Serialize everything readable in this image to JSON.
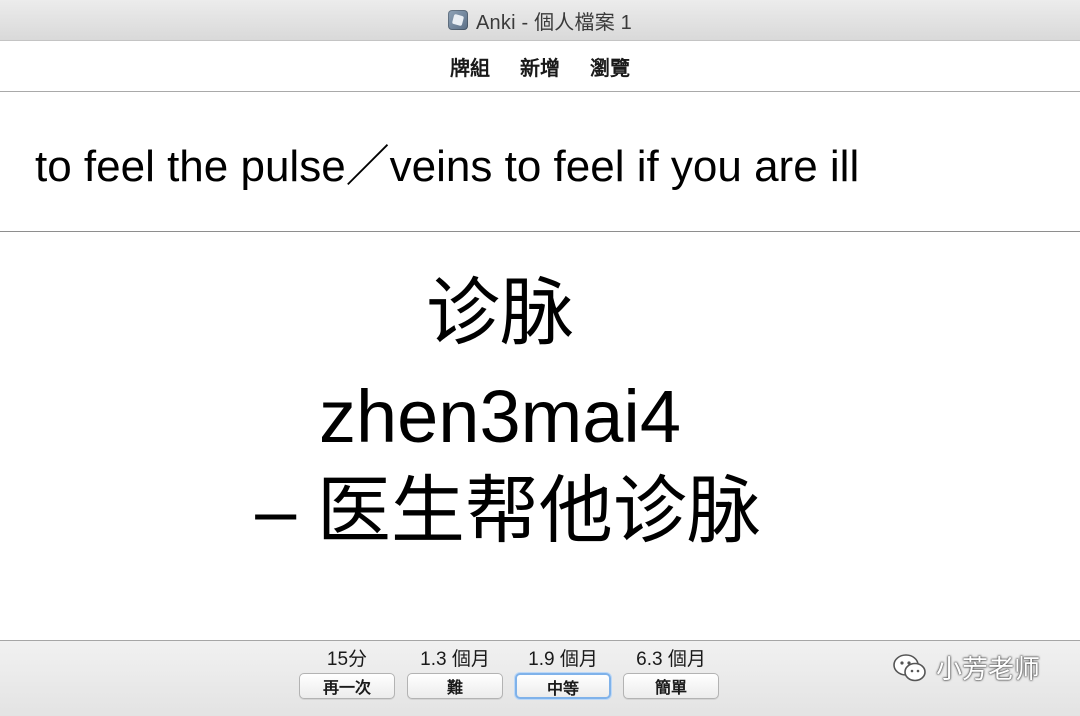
{
  "window": {
    "title": "Anki - 個人檔案 1",
    "icon": "anki-icon"
  },
  "toolbar": {
    "items": [
      {
        "label": "牌組"
      },
      {
        "label": "新增"
      },
      {
        "label": "瀏覽"
      }
    ]
  },
  "card": {
    "question": "to feel the pulse／veins to feel if you are ill",
    "answer_word": "诊脉",
    "answer_pinyin": "zhen3mai4",
    "answer_example": "– 医生帮他诊脉"
  },
  "answer_bar": {
    "buttons": [
      {
        "interval": "15分",
        "label": "再一次"
      },
      {
        "interval": "1.3 個月",
        "label": "難"
      },
      {
        "interval": "1.9 個月",
        "label": "中等"
      },
      {
        "interval": "6.3 個月",
        "label": "簡單"
      }
    ],
    "focused_index": 2
  },
  "watermark": {
    "icon": "wechat-icon",
    "text": "小芳老师"
  },
  "colors": {
    "focus_ring": "#7fb2ea",
    "divider": "#8e8e8e"
  }
}
